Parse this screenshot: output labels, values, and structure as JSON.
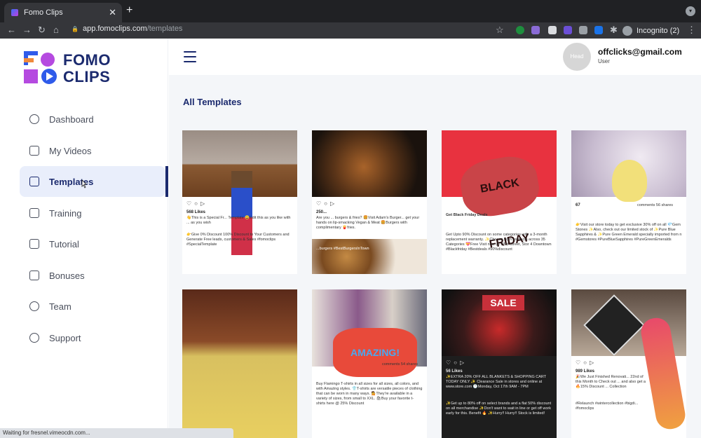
{
  "browser": {
    "tab_title": "Fomo Clips",
    "tab_close": "✕",
    "new_tab": "+",
    "back": "←",
    "forward": "→",
    "reload": "↻",
    "home": "⌂",
    "lock": "🔒",
    "url_host": "app.fomoclips.com",
    "url_path": "/templates",
    "star": "☆",
    "extensions": "✱",
    "incognito_label": "Incognito (2)",
    "menu": "⋮",
    "profile_menu": "▾"
  },
  "sidebar": {
    "logo_line1": "FOMO",
    "logo_line2": "CLIPS",
    "items": [
      {
        "label": "Dashboard",
        "icon": "dashboard-icon"
      },
      {
        "label": "My Videos",
        "icon": "videos-icon"
      },
      {
        "label": "Templates",
        "icon": "templates-icon"
      },
      {
        "label": "Training",
        "icon": "training-icon"
      },
      {
        "label": "Tutorial",
        "icon": "tutorial-icon"
      },
      {
        "label": "Bonuses",
        "icon": "bonuses-icon"
      },
      {
        "label": "Team",
        "icon": "team-icon"
      },
      {
        "label": "Support",
        "icon": "support-icon"
      }
    ],
    "active": "Templates"
  },
  "header": {
    "avatar_text": "Head",
    "user_email": "offclicks@gmail.com",
    "user_role": "User"
  },
  "main": {
    "title": "All Templates",
    "templates": [
      {
        "likes": "568 Likes",
        "text": "👋This is a Special Fr... Template 😀Edit this as you like with ... as you wish",
        "text2": "👉Give 0% Discount 100% Discount to Your Customers and Generate Free leads, customers & Sales #fomoclips #SpecialTemplate"
      },
      {
        "likes": "250...",
        "text": "Are you ... burgers & fries? 🍔Visit Adam's Burger... get your hands on lip-smacking Vegan & Meat 🍔Burgers with complimentary 🍟fries.",
        "text2": "...burgers #BestBurgersInTown"
      },
      {
        "likes": "",
        "text": "Get Black Friday Deals",
        "text2": "Get Upto 90% Discount on some categories with a 3-month replacement warranty. ✨Choose from products across 35 Categories 💝Free Visit now @ 23rd Street, Stor 4 Downtown #Blackfriday #Bestdeals #90%discount"
      },
      {
        "likes": "67",
        "text": "comments 56 shares",
        "text2": "👉Visit our store today to get exclusive 30% off on all 💎Gem Stones ✨Also, check out our limited stock of ✨Pure Blue Sapphires & ✨Pure Green Emerald specially imported from n #Gemstores #PureBlueSapphires #PureGreenEmeralds"
      },
      {
        "likes": "",
        "text": "",
        "text2": ""
      },
      {
        "likes": "",
        "text": "comments 54 shares",
        "text2": "Buy Flamingo T-shirts in all sizes for all sizes, all colors, and with Amazing styles. 👕T-shirts are versatile pieces of clothing that can be worn in many ways. 💁They're available in a variety of sizes, from small to XXL. 🛍Buy your favorite t-shirts here @ 25% Discount"
      },
      {
        "likes": "56 Likes",
        "text": "✨EXTRA 20% OFF ALL BLANKETS & SHOPPING CART TODAY ONLY ✨ Clearance Sale in stores and online at www.store.com 🕐Monday, Oct 17th 9AM - 7PM",
        "text2": "✨Get up to 80% off on select brands and a flat 50% discount on all merchandise ✨Don't want to wait in line or get off work early for this. Benefit 🔥 ✨Hurry!! Hurry!! Stock is limited!"
      },
      {
        "likes": "989 Likes",
        "text": "🎉We Just Finished Renovati... 22nd of this Month to Check out ... and also get a 🔥15% Discount ... Collection",
        "text2": "#Relaunch #wintercollection #bigdi... #fomoclips"
      }
    ]
  },
  "status_text": "Waiting for fresnel.vimeocdn.com...",
  "colors": {
    "brand_navy": "#1b2a6e",
    "active_bg": "#e9eefb",
    "logo_blue": "#2f5bea",
    "logo_purple": "#b54ae0",
    "logo_orange": "#f08a3c"
  }
}
